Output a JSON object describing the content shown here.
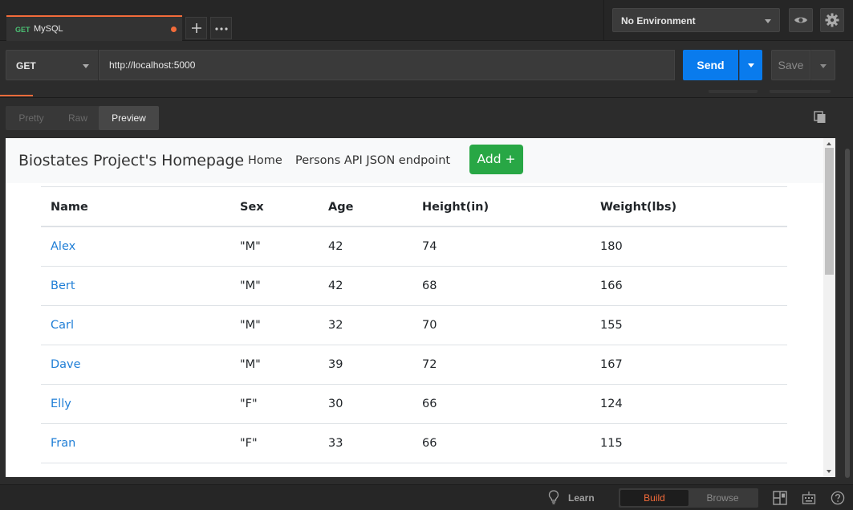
{
  "tabs": {
    "active": {
      "method": "GET",
      "name": "MySQL"
    }
  },
  "environment": {
    "selected": "No Environment"
  },
  "request": {
    "method": "GET",
    "url": "http://localhost:5000",
    "send_label": "Send",
    "save_label": "Save"
  },
  "response_view": {
    "modes": [
      "Pretty",
      "Raw",
      "Preview"
    ],
    "active_mode": "Preview"
  },
  "preview": {
    "brand": "Biostates Project's Homepage",
    "nav": [
      "Home",
      "Persons API JSON endpoint"
    ],
    "add_button": "Add +",
    "table": {
      "headers": [
        "Name",
        "Sex",
        "Age",
        "Height(in)",
        "Weight(lbs)"
      ],
      "rows": [
        [
          "Alex",
          "\"M\"",
          "42",
          "74",
          "180"
        ],
        [
          "Bert",
          "\"M\"",
          "42",
          "68",
          "166"
        ],
        [
          "Carl",
          "\"M\"",
          "32",
          "70",
          "155"
        ],
        [
          "Dave",
          "\"M\"",
          "39",
          "72",
          "167"
        ],
        [
          "Elly",
          "\"F\"",
          "30",
          "66",
          "124"
        ],
        [
          "Fran",
          "\"F\"",
          "33",
          "66",
          "115"
        ]
      ]
    }
  },
  "statusbar": {
    "learn": "Learn",
    "modes": [
      "Build",
      "Browse"
    ],
    "active_mode": "Build"
  },
  "colors": {
    "accent_orange": "#f26b3a",
    "send_blue": "#097bed",
    "add_green": "#28a745",
    "link_blue": "#1f7ed6"
  },
  "icons": [
    "plus-icon",
    "ellipsis-icon",
    "eye-icon",
    "gear-icon",
    "copy-icon",
    "lightbulb-icon",
    "two-pane-icon",
    "keyboard-icon",
    "help-icon"
  ]
}
